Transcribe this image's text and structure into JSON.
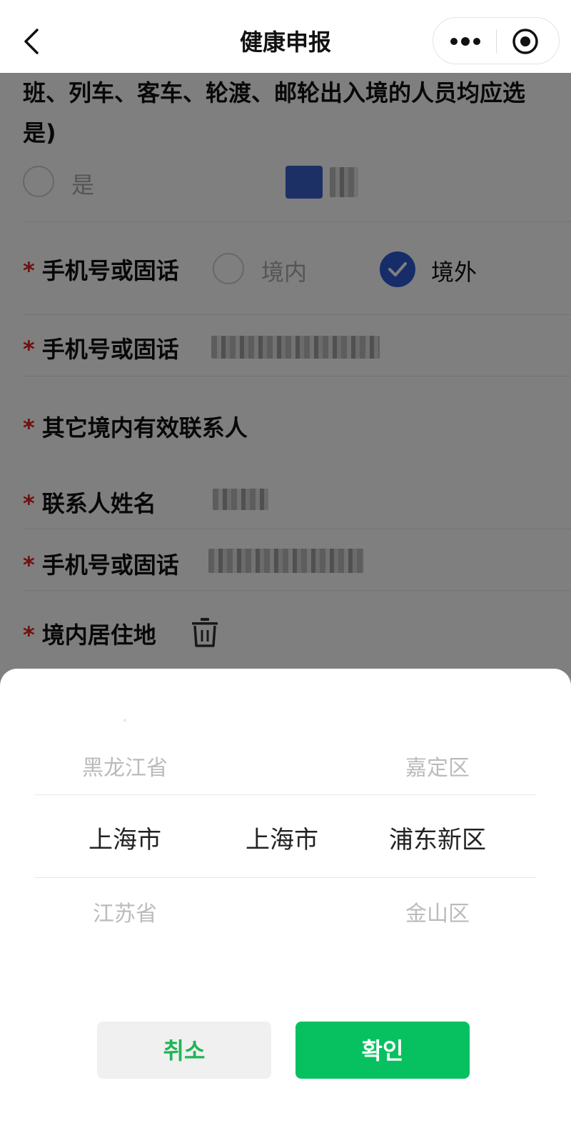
{
  "nav": {
    "title": "健康申报"
  },
  "form": {
    "question_tail": "班、列车、客车、轮渡、邮轮出入境的人员均应选是)",
    "yes_label": "是",
    "phone_type": {
      "label": "手机号或固话",
      "opt_domestic": "境内",
      "opt_abroad": "境外",
      "selected": "境外"
    },
    "phone": {
      "label": "手机号或固话"
    },
    "contact_section": {
      "label": "其它境内有效联系人"
    },
    "contact_name": {
      "label": "联系人姓名"
    },
    "contact_phone": {
      "label": "手机号或固话"
    },
    "residence": {
      "label": "境内居住地"
    },
    "required_mark": "*"
  },
  "picker": {
    "province": {
      "above": "黑龙江省",
      "selected": "上海市",
      "below": "江苏省"
    },
    "city": {
      "selected": "上海市"
    },
    "district": {
      "above": "嘉定区",
      "selected": "浦东新区",
      "below": "金山区"
    }
  },
  "buttons": {
    "cancel": "취소",
    "confirm": "확인"
  },
  "colors": {
    "confirm_bg": "#07c160",
    "cancel_text": "#20b456",
    "radio_checked": "#2d5ad4",
    "required": "#e02020"
  }
}
